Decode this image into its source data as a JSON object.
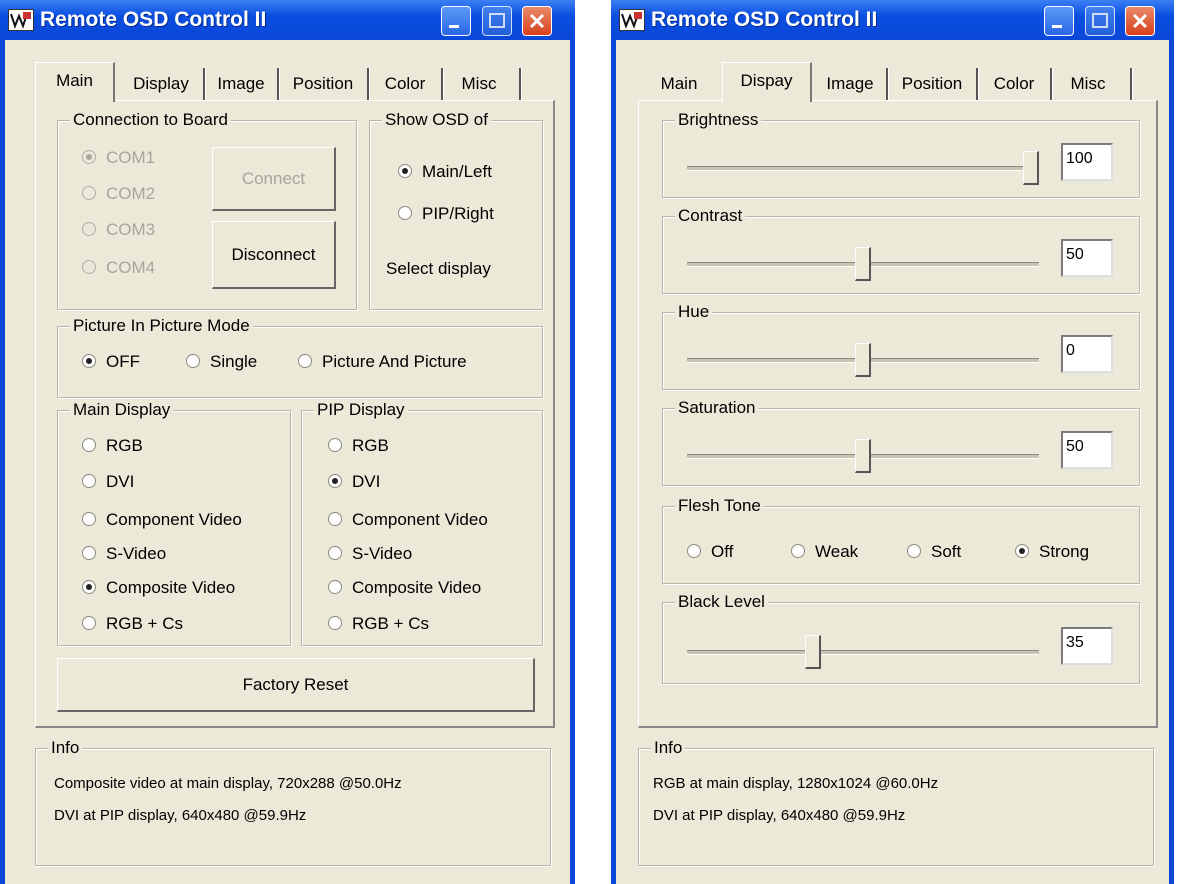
{
  "left": {
    "title": "Remote OSD Control II",
    "tabs": [
      "Main",
      "Display",
      "Image",
      "Position",
      "Color",
      "Misc"
    ],
    "connection": {
      "legend": "Connection to Board",
      "ports": [
        "COM1",
        "COM2",
        "COM3",
        "COM4"
      ],
      "connect_label": "Connect",
      "disconnect_label": "Disconnect"
    },
    "show_osd": {
      "legend": "Show OSD of",
      "options": [
        "Main/Left",
        "PIP/Right"
      ],
      "select_label": "Select display"
    },
    "pip_mode": {
      "legend": "Picture In Picture Mode",
      "options": [
        "OFF",
        "Single",
        "Picture And Picture"
      ]
    },
    "main_display": {
      "legend": "Main Display",
      "options": [
        "RGB",
        "DVI",
        "Component Video",
        "S-Video",
        "Composite Video",
        "RGB + Cs"
      ]
    },
    "pip_display": {
      "legend": "PIP Display",
      "options": [
        "RGB",
        "DVI",
        "Component Video",
        "S-Video",
        "Composite Video",
        "RGB + Cs"
      ]
    },
    "factory_reset_label": "Factory Reset",
    "info": {
      "legend": "Info",
      "lines": [
        "Composite video at main display, 720x288 @50.0Hz",
        "DVI at PIP display, 640x480 @59.9Hz"
      ]
    }
  },
  "right": {
    "title": "Remote OSD Control II",
    "tabs": [
      "Main",
      "Dispay",
      "Image",
      "Position",
      "Color",
      "Misc"
    ],
    "sliders": [
      {
        "label": "Brightness",
        "value": "100",
        "min": 0,
        "max": 100,
        "level": 100
      },
      {
        "label": "Contrast",
        "value": "50",
        "min": 0,
        "max": 100,
        "level": 50
      },
      {
        "label": "Hue",
        "value": "0",
        "min": -50,
        "max": 50,
        "level": 0
      },
      {
        "label": "Saturation",
        "value": "50",
        "min": 0,
        "max": 100,
        "level": 50
      }
    ],
    "flesh_tone": {
      "legend": "Flesh Tone",
      "options": [
        "Off",
        "Weak",
        "Soft",
        "Strong"
      ]
    },
    "black_level": {
      "label": "Black Level",
      "value": "35",
      "min": 0,
      "max": 100,
      "level": 35
    },
    "info": {
      "legend": "Info",
      "lines": [
        "RGB at main display, 1280x1024 @60.0Hz",
        "DVI at PIP display, 640x480 @59.9Hz"
      ]
    }
  }
}
